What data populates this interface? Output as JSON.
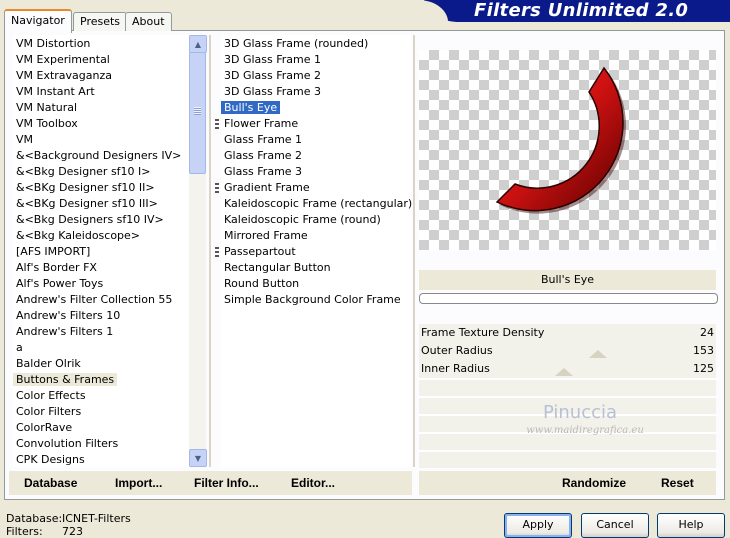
{
  "header": {
    "title": "Filters Unlimited 2.0"
  },
  "tabs": [
    {
      "label": "Navigator",
      "active": true
    },
    {
      "label": "Presets",
      "active": false
    },
    {
      "label": "About",
      "active": false
    }
  ],
  "categories": [
    {
      "label": "VM Distortion"
    },
    {
      "label": "VM Experimental"
    },
    {
      "label": "VM Extravaganza"
    },
    {
      "label": "VM Instant Art"
    },
    {
      "label": "VM Natural"
    },
    {
      "label": "VM Toolbox"
    },
    {
      "label": "VM"
    },
    {
      "label": "&<Background Designers IV>"
    },
    {
      "label": "&<Bkg Designer sf10 I>"
    },
    {
      "label": "&<BKg Designer sf10 II>"
    },
    {
      "label": "&<BKg Designer sf10 III>"
    },
    {
      "label": "&<Bkg Designers sf10 IV>"
    },
    {
      "label": "&<Bkg Kaleidoscope>"
    },
    {
      "label": "[AFS IMPORT]"
    },
    {
      "label": "Alf's Border FX"
    },
    {
      "label": "Alf's Power Toys"
    },
    {
      "label": "Andrew's Filter Collection 55"
    },
    {
      "label": "Andrew's Filters 10"
    },
    {
      "label": "Andrew's Filters 1"
    },
    {
      "label": "a"
    },
    {
      "label": "Balder Olrik"
    },
    {
      "label": "Buttons & Frames",
      "selected": true
    },
    {
      "label": "Color Effects"
    },
    {
      "label": "Color Filters"
    },
    {
      "label": "ColorRave"
    },
    {
      "label": "Convolution Filters"
    },
    {
      "label": "CPK Designs"
    }
  ],
  "filters": [
    {
      "label": "3D Glass Frame (rounded)"
    },
    {
      "label": "3D Glass Frame 1"
    },
    {
      "label": "3D Glass Frame 2"
    },
    {
      "label": "3D Glass Frame 3"
    },
    {
      "label": "Bull's Eye",
      "selected": true
    },
    {
      "label": "Flower Frame",
      "grip": true
    },
    {
      "label": "Glass Frame 1"
    },
    {
      "label": "Glass Frame 2"
    },
    {
      "label": "Glass Frame 3"
    },
    {
      "label": "Gradient Frame",
      "grip": true
    },
    {
      "label": "Kaleidoscopic Frame (rectangular)"
    },
    {
      "label": "Kaleidoscopic Frame (round)"
    },
    {
      "label": "Mirrored Frame"
    },
    {
      "label": "Passepartout",
      "grip": true
    },
    {
      "label": "Rectangular Button"
    },
    {
      "label": "Round Button"
    },
    {
      "label": "Simple Background Color Frame"
    }
  ],
  "preview": {
    "filter_name": "Bull's Eye",
    "ring_color": "#cc1111",
    "progress": 0
  },
  "params": [
    {
      "label": "Frame Texture Density",
      "value": "24"
    },
    {
      "label": "Outer Radius",
      "value": "153"
    },
    {
      "label": "Inner Radius",
      "value": "125"
    }
  ],
  "watermark": {
    "line1": "Pinuccia",
    "line2": "www.maidiregrafica.eu"
  },
  "bottom_links": {
    "database": "Database",
    "import": "Import...",
    "filter_info": "Filter Info...",
    "editor": "Editor...",
    "randomize": "Randomize",
    "reset": "Reset"
  },
  "status": {
    "database_label": "Database:",
    "database_value": "ICNET-Filters",
    "filters_label": "Filters:",
    "filters_value": "723"
  },
  "buttons": {
    "apply": "Apply",
    "cancel": "Cancel",
    "help": "Help"
  }
}
